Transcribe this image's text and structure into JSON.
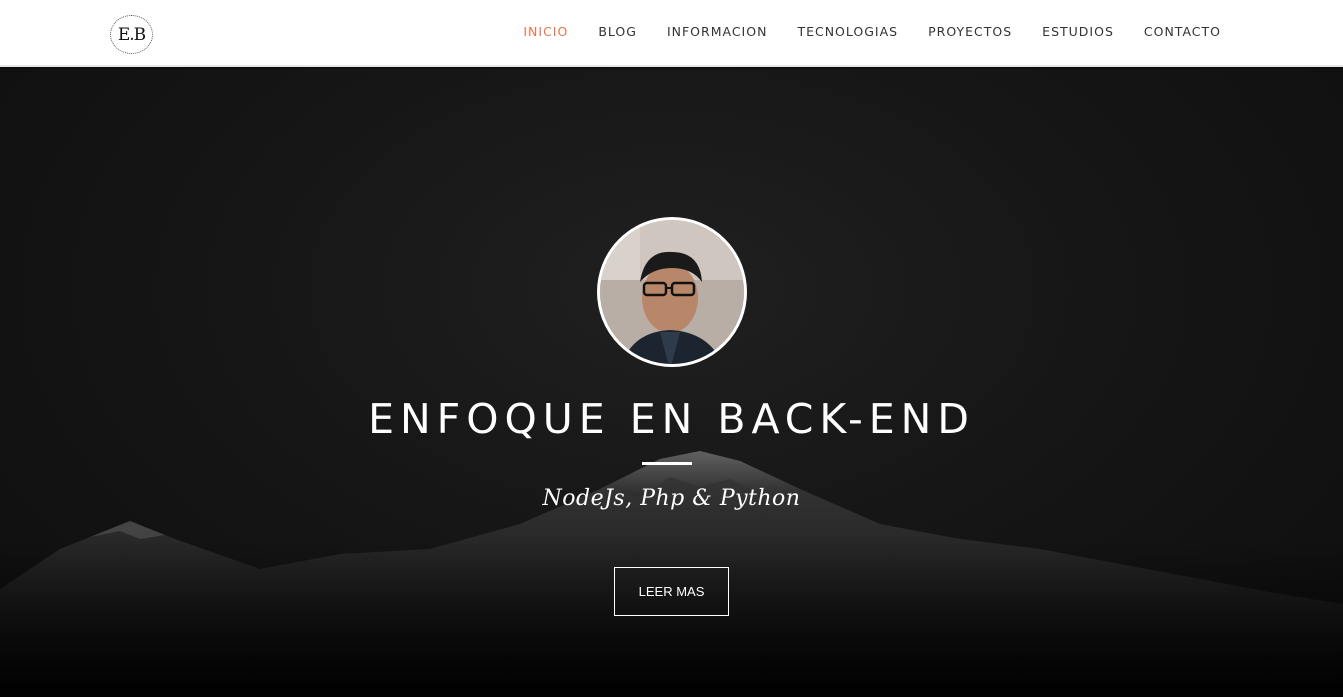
{
  "brand": {
    "logo_text": "E.B"
  },
  "nav": {
    "items": [
      {
        "label": "INICIO",
        "active": true
      },
      {
        "label": "BLOG",
        "active": false
      },
      {
        "label": "INFORMACION",
        "active": false
      },
      {
        "label": "TECNOLOGIAS",
        "active": false
      },
      {
        "label": "PROYECTOS",
        "active": false
      },
      {
        "label": "ESTUDIOS",
        "active": false
      },
      {
        "label": "CONTACTO",
        "active": false
      }
    ]
  },
  "hero": {
    "title": "ENFOQUE EN BACK-END",
    "subtitle": "NodeJs, Php & Python",
    "cta_label": "LEER MAS",
    "background": "dark-mountain-photo"
  },
  "colors": {
    "accent": "#e8734a",
    "nav_text": "#333333",
    "hero_text": "#ffffff"
  }
}
